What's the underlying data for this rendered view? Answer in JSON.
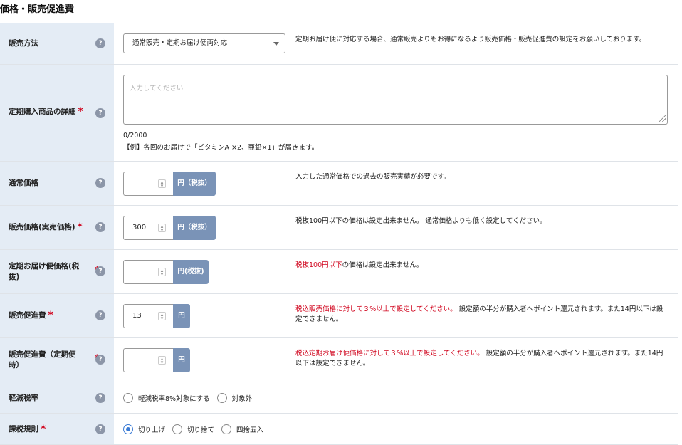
{
  "section_title": "価格・販売促進費",
  "rows": {
    "sales_method": {
      "label": "販売方法",
      "select_value": "通常販売・定期お届け便両対応",
      "note": "定期お届け便に対応する場合、通常販売よりもお得になるよう販売価格・販売促進費の設定をお願いしております。"
    },
    "subscription_detail": {
      "label": "定期購入商品の詳細",
      "required": "*",
      "placeholder": "入力してください",
      "counter": "0/2000",
      "example": "【例】各回のお届けで「ビタミンA ×2、亜鉛×1」が届きます。"
    },
    "regular_price": {
      "label": "通常価格",
      "value": "",
      "unit": "円（税抜）",
      "note": "入力した通常価格での過去の販売実績が必要です。"
    },
    "sale_price": {
      "label": "販売価格(実売価格)",
      "required": "*",
      "value": "300",
      "unit": "円（税抜）",
      "note": "税抜100円以下の価格は設定出来ません。 通常価格よりも低く設定してください。"
    },
    "subscription_price": {
      "label": "定期お届け便価格(税抜)",
      "required": "*",
      "value": "",
      "unit": "円(税抜)",
      "note_red": "税抜100円以下",
      "note_rest": "の価格は設定出来ません。"
    },
    "promo_fee": {
      "label": "販売促進費",
      "required": "*",
      "value": "13",
      "unit": "円",
      "note_red": "税込販売価格に対して３%以上で設定してください。",
      "note_rest": " 設定額の半分が購入者へポイント還元されます。また14円以下は設定できません。"
    },
    "promo_fee_sub": {
      "label": "販売促進費（定期便時）",
      "required": "*",
      "value": "",
      "unit": "円",
      "note_red": "税込定期お届け便価格に対して３%以上で設定してください。",
      "note_rest": " 設定額の半分が購入者へポイント還元されます。また14円以下は設定できません。"
    },
    "reduced_tax": {
      "label": "軽減税率",
      "options": [
        "軽減税率8%対象にする",
        "対象外"
      ]
    },
    "tax_rounding": {
      "label": "課税規則",
      "required": "*",
      "options": [
        "切り上げ",
        "切り捨て",
        "四捨五入"
      ],
      "selected": "切り上げ"
    }
  },
  "help_symbol": "?",
  "colors": {
    "label_bg": "#e4ecf5",
    "unit_bg": "#7a93b7",
    "required": "#d0021b",
    "radio_checked": "#3a7bd5"
  }
}
